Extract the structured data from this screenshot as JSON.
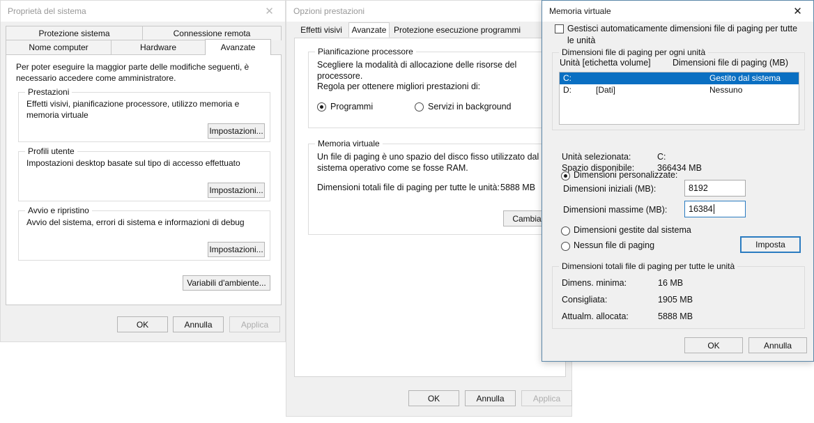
{
  "system_properties": {
    "title": "Proprietà del sistema",
    "close_icon": "close-icon",
    "tabs_row1": [
      {
        "label": "Protezione sistema",
        "selected": false
      },
      {
        "label": "Connessione remota",
        "selected": false
      }
    ],
    "tabs_row2": [
      {
        "label": "Nome computer",
        "selected": false
      },
      {
        "label": "Hardware",
        "selected": false
      },
      {
        "label": "Avanzate",
        "selected": true
      }
    ],
    "intro": "Per poter eseguire la maggior parte delle modifiche seguenti, è necessario accedere come amministratore.",
    "groups": [
      {
        "label": "Prestazioni",
        "description": "Effetti visivi, pianificazione processore, utilizzo memoria e memoria virtuale",
        "button": "Impostazioni..."
      },
      {
        "label": "Profili utente",
        "description": "Impostazioni desktop basate sul tipo di accesso effettuato",
        "button": "Impostazioni..."
      },
      {
        "label": "Avvio e ripristino",
        "description": "Avvio del sistema, errori di sistema e informazioni di debug",
        "button": "Impostazioni..."
      }
    ],
    "env_button": "Variabili d'ambiente...",
    "footer": {
      "ok": "OK",
      "cancel": "Annulla",
      "apply": "Applica",
      "apply_disabled": true
    }
  },
  "performance_options": {
    "title": "Opzioni prestazioni",
    "tabs": [
      {
        "label": "Effetti visivi",
        "selected": false
      },
      {
        "label": "Avanzate",
        "selected": true
      },
      {
        "label": "Protezione esecuzione programmi",
        "selected": false
      }
    ],
    "processor_group": {
      "label": "Pianificazione processore",
      "description": "Scegliere la modalità di allocazione delle risorse del processore.",
      "prompt": "Regola per ottenere migliori prestazioni di:",
      "options": [
        {
          "label": "Programmi",
          "selected": true
        },
        {
          "label": "Servizi in background",
          "selected": false
        }
      ]
    },
    "virtual_memory_group": {
      "label": "Memoria virtuale",
      "description": "Un file di paging è uno spazio del disco fisso utilizzato dal sistema operativo come se fosse RAM.",
      "total_label": "Dimensioni totali file di paging per tutte le unità:",
      "total_value": "5888 MB",
      "change_button": "Cambia..."
    },
    "footer": {
      "ok": "OK",
      "cancel": "Annulla",
      "apply": "Applica",
      "apply_disabled": true
    }
  },
  "virtual_memory": {
    "title": "Memoria virtuale",
    "close_icon": "close-icon",
    "auto_manage": {
      "label": "Gestisci automaticamente dimensioni file di paging per tutte le unità",
      "checked": false
    },
    "per_drive_group": {
      "label": "Dimensioni file di paging per ogni unità",
      "columns": [
        "Unità [etichetta volume]",
        "Dimensioni file di paging (MB)"
      ],
      "rows": [
        {
          "drive": "C:",
          "volume_label": "",
          "paging_size": "Gestito dal sistema",
          "selected": true
        },
        {
          "drive": "D:",
          "volume_label": "[Dati]",
          "paging_size": "Nessuno",
          "selected": false
        }
      ]
    },
    "selected_drive_label": "Unità selezionata:",
    "selected_drive_value": "C:",
    "available_space_label": "Spazio disponibile:",
    "available_space_value": "366434 MB",
    "size_options": [
      {
        "label": "Dimensioni personalizzate:",
        "selected": true
      },
      {
        "label": "Dimensioni gestite dal sistema",
        "selected": false
      },
      {
        "label": "Nessun file di paging",
        "selected": false
      }
    ],
    "initial_size_label": "Dimensioni iniziali (MB):",
    "initial_size_value": "8192",
    "max_size_label": "Dimensioni massime (MB):",
    "max_size_value": "16384",
    "set_button": "Imposta",
    "totals_group": {
      "label": "Dimensioni totali file di paging per tutte le unità",
      "rows": [
        {
          "label": "Dimens. minima:",
          "value": "16 MB"
        },
        {
          "label": "Consigliata:",
          "value": "1905 MB"
        },
        {
          "label": "Attualm. allocata:",
          "value": "5888 MB"
        }
      ]
    },
    "footer": {
      "ok": "OK",
      "cancel": "Annulla"
    },
    "accent_color": "#2a7bc0",
    "selection_color": "#0a6fc2"
  }
}
